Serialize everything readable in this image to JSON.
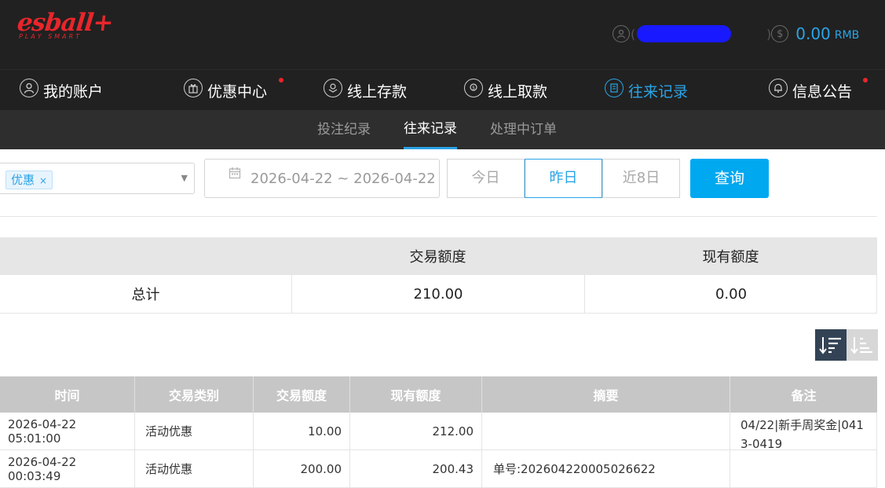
{
  "header": {
    "logo_text": "esball+",
    "logo_tagline": "PLAY SMART",
    "balance": "0.00",
    "currency": "RMB"
  },
  "nav": {
    "items": [
      {
        "label": "我的账户",
        "icon": "user-icon"
      },
      {
        "label": "优惠中心",
        "icon": "gift-icon",
        "dot": true
      },
      {
        "label": "线上存款",
        "icon": "deposit-icon"
      },
      {
        "label": "线上取款",
        "icon": "withdraw-icon"
      },
      {
        "label": "往来记录",
        "icon": "records-icon",
        "active": true
      },
      {
        "label": "信息公告",
        "icon": "bell-icon",
        "dot": true
      }
    ]
  },
  "subnav": {
    "tabs": [
      {
        "label": "投注纪录"
      },
      {
        "label": "往来记录",
        "active": true
      },
      {
        "label": "处理中订单"
      }
    ]
  },
  "filters": {
    "type_tag": "优惠",
    "date_range": "2026-04-22 ~ 2026-04-22",
    "quick": [
      "今日",
      "昨日",
      "近8日"
    ],
    "quick_active": "昨日",
    "query_label": "查询"
  },
  "summary": {
    "headers": [
      "",
      "交易额度",
      "现有额度"
    ],
    "row": [
      "总计",
      "210.00",
      "0.00"
    ]
  },
  "records": {
    "headers": [
      "时间",
      "交易类别",
      "交易额度",
      "现有额度",
      "摘要",
      "备注"
    ],
    "rows": [
      [
        "2026-04-22 05:01:00",
        "活动优惠",
        "10.00",
        "212.00",
        "",
        "04/22|新手周奖金|0413-0419"
      ],
      [
        "2026-04-22 00:03:49",
        "活动优惠",
        "200.00",
        "200.43",
        "单号:202604220005026622",
        ""
      ]
    ]
  },
  "colors": {
    "accent": "#2aa4e6",
    "brand_red": "#e8262b",
    "dark_bg": "#212121",
    "query_button": "#00a8f0",
    "sort_active": "#334355"
  }
}
